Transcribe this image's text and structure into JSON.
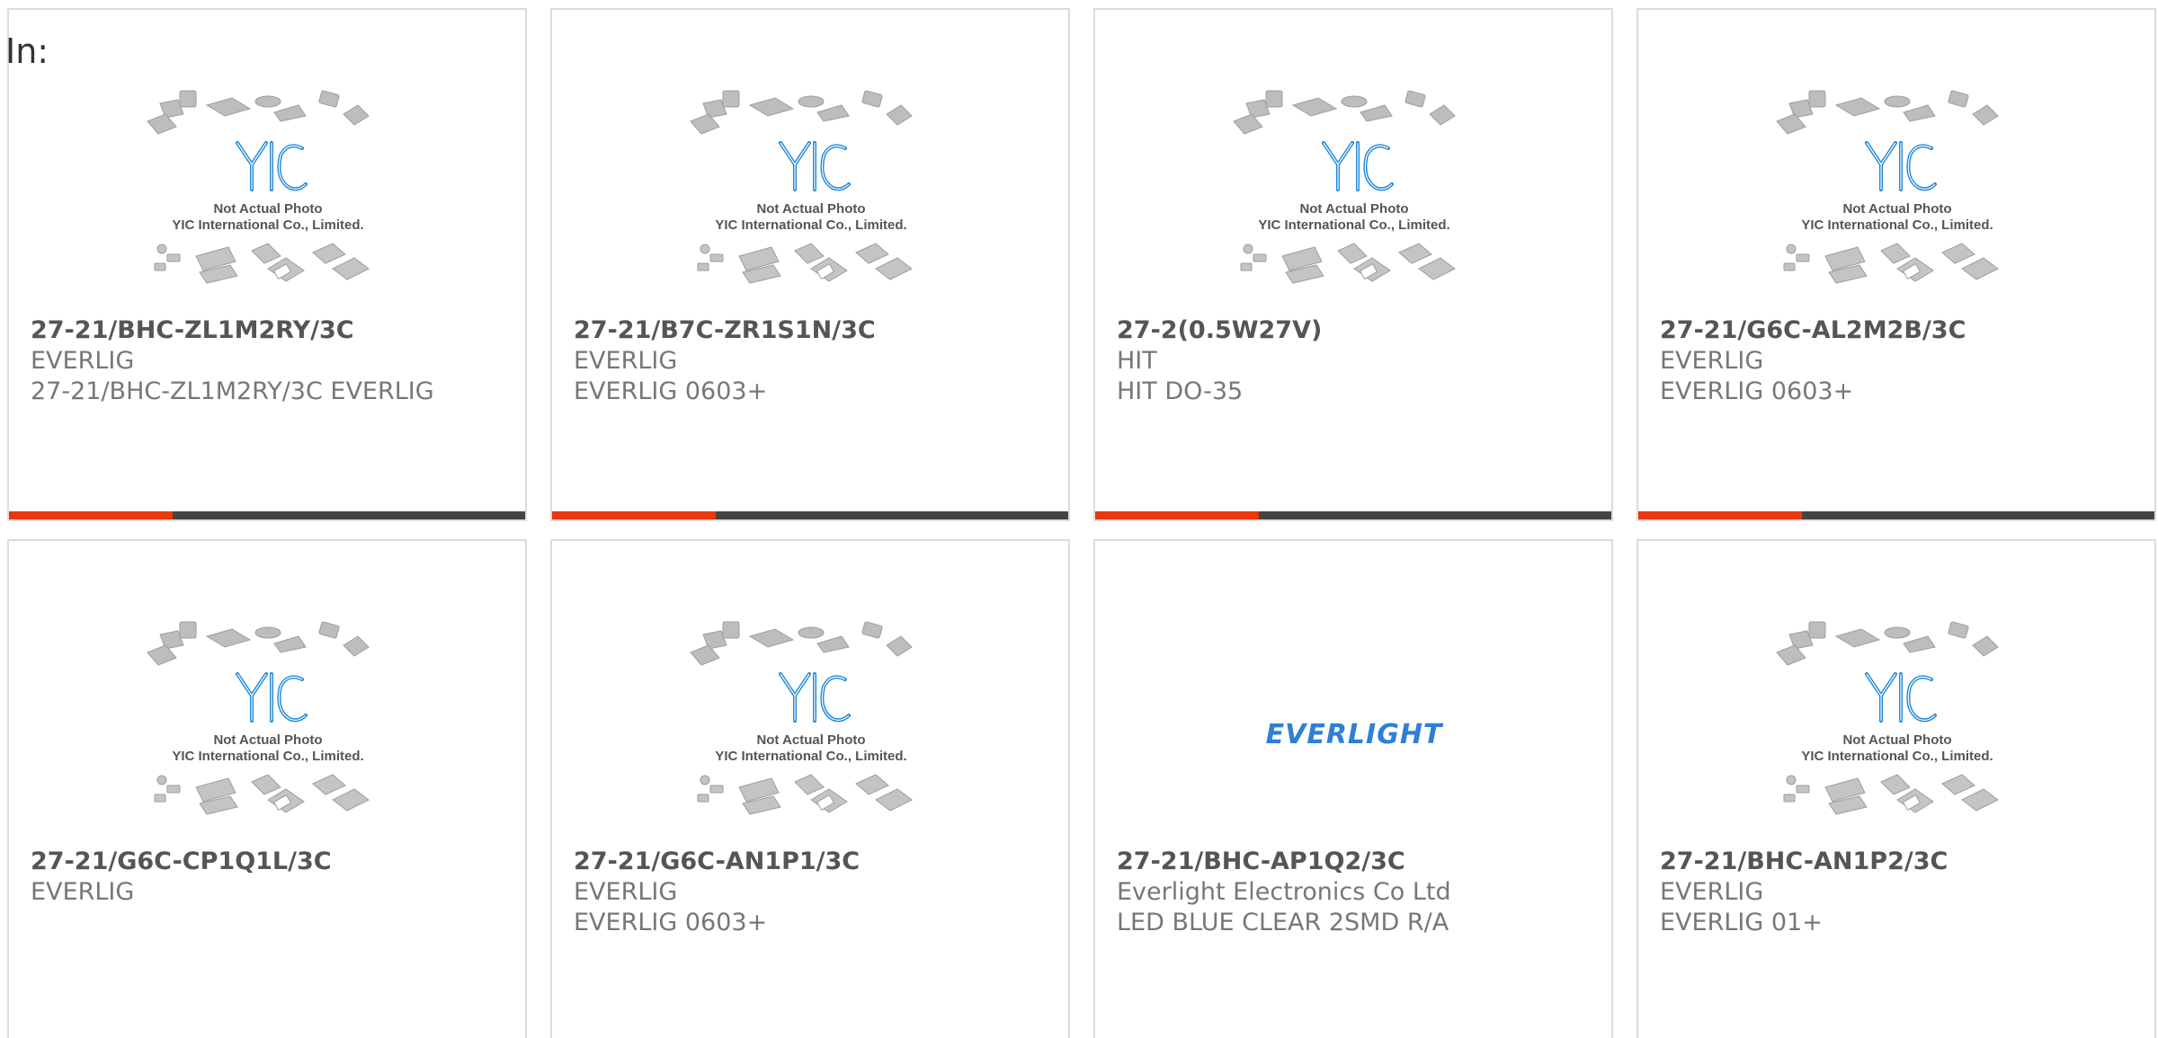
{
  "page": {
    "label": "In:"
  },
  "placeholder": {
    "logo_text": "YIC",
    "line1": "Not Actual Photo",
    "line2": "YIC International Co., Limited."
  },
  "colors": {
    "accent": "#e8380d",
    "bar": "#444444",
    "logo_blue": "#1e88d8",
    "chip_gray": "#b5b5b5"
  },
  "products": [
    {
      "part_number": "27-21/BHC-ZL1M2RY/3C",
      "manufacturer": "EVERLIG",
      "description": "27-21/BHC-ZL1M2RY/3C EVERLIG",
      "image": "placeholder",
      "show_bar": true
    },
    {
      "part_number": "27-21/B7C-ZR1S1N/3C",
      "manufacturer": "EVERLIG",
      "description": "EVERLIG 0603+",
      "image": "placeholder",
      "show_bar": true
    },
    {
      "part_number": "27-2(0.5W27V)",
      "manufacturer": "HIT",
      "description": "HIT DO-35",
      "image": "placeholder",
      "show_bar": true
    },
    {
      "part_number": "27-21/G6C-AL2M2B/3C",
      "manufacturer": "EVERLIG",
      "description": "EVERLIG 0603+",
      "image": "placeholder",
      "show_bar": true
    },
    {
      "part_number": "27-21/G6C-CP1Q1L/3C",
      "manufacturer": "EVERLIG",
      "description": "",
      "image": "placeholder",
      "show_bar": false
    },
    {
      "part_number": "27-21/G6C-AN1P1/3C",
      "manufacturer": "EVERLIG",
      "description": "EVERLIG 0603+",
      "image": "placeholder",
      "show_bar": false
    },
    {
      "part_number": "27-21/BHC-AP1Q2/3C",
      "manufacturer": "Everlight Electronics Co Ltd",
      "description": "LED BLUE CLEAR 2SMD R/A",
      "image": "brand",
      "brand_logo_text": "EVERLIGHT",
      "show_bar": false
    },
    {
      "part_number": "27-21/BHC-AN1P2/3C",
      "manufacturer": "EVERLIG",
      "description": "EVERLIG 01+",
      "image": "placeholder",
      "show_bar": false
    }
  ]
}
